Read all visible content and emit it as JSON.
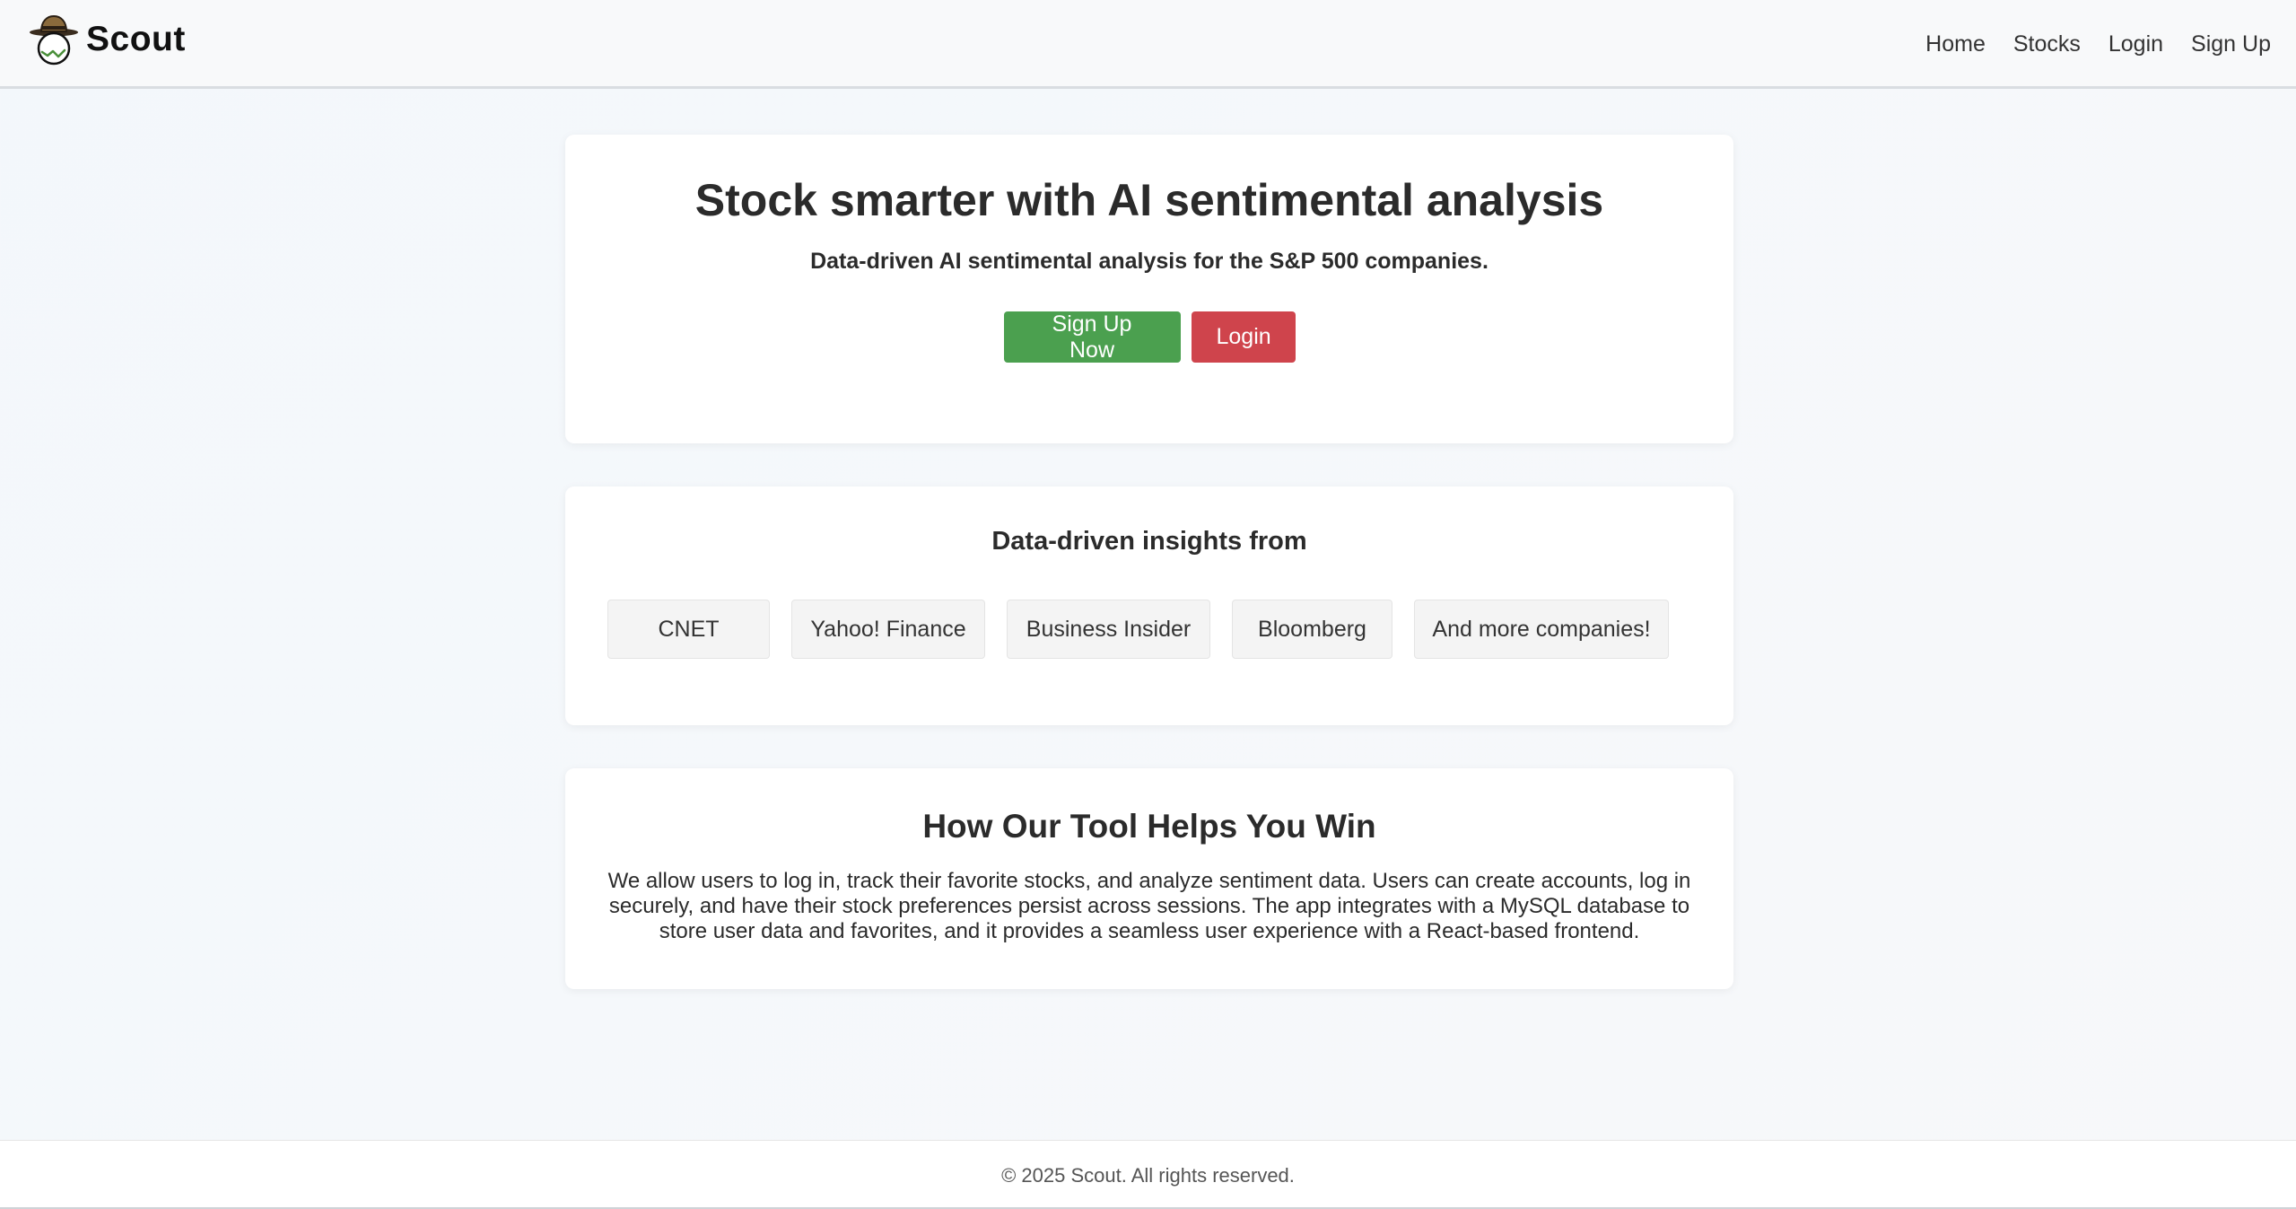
{
  "header": {
    "brand_name": "Scout",
    "nav": [
      "Home",
      "Stocks",
      "Login",
      "Sign Up"
    ]
  },
  "hero": {
    "title": "Stock smarter with AI sentimental analysis",
    "subtitle": "Data-driven AI sentimental analysis for the S&P 500 companies.",
    "signup_label": "Sign Up Now",
    "login_label": "Login"
  },
  "insights": {
    "title": "Data-driven insights from",
    "sources": [
      "CNET",
      "Yahoo! Finance",
      "Business Insider",
      "Bloomberg",
      "And more companies!"
    ]
  },
  "how": {
    "title": "How Our Tool Helps You Win",
    "text": "We allow users to log in, track their favorite stocks, and analyze sentiment data. Users can create accounts, log in securely, and have their stock preferences persist across sessions. The app integrates with a MySQL database to store user data and favorites, and it provides a seamless user experience with a React-based frontend."
  },
  "footer": {
    "copyright": "© 2025 Scout. All rights reserved."
  },
  "colors": {
    "signup_button": "#4ba04f",
    "login_button": "#cf444c",
    "chip_background": "#f4f4f4"
  },
  "icons": {
    "logo": "scout-hat-face-icon"
  }
}
